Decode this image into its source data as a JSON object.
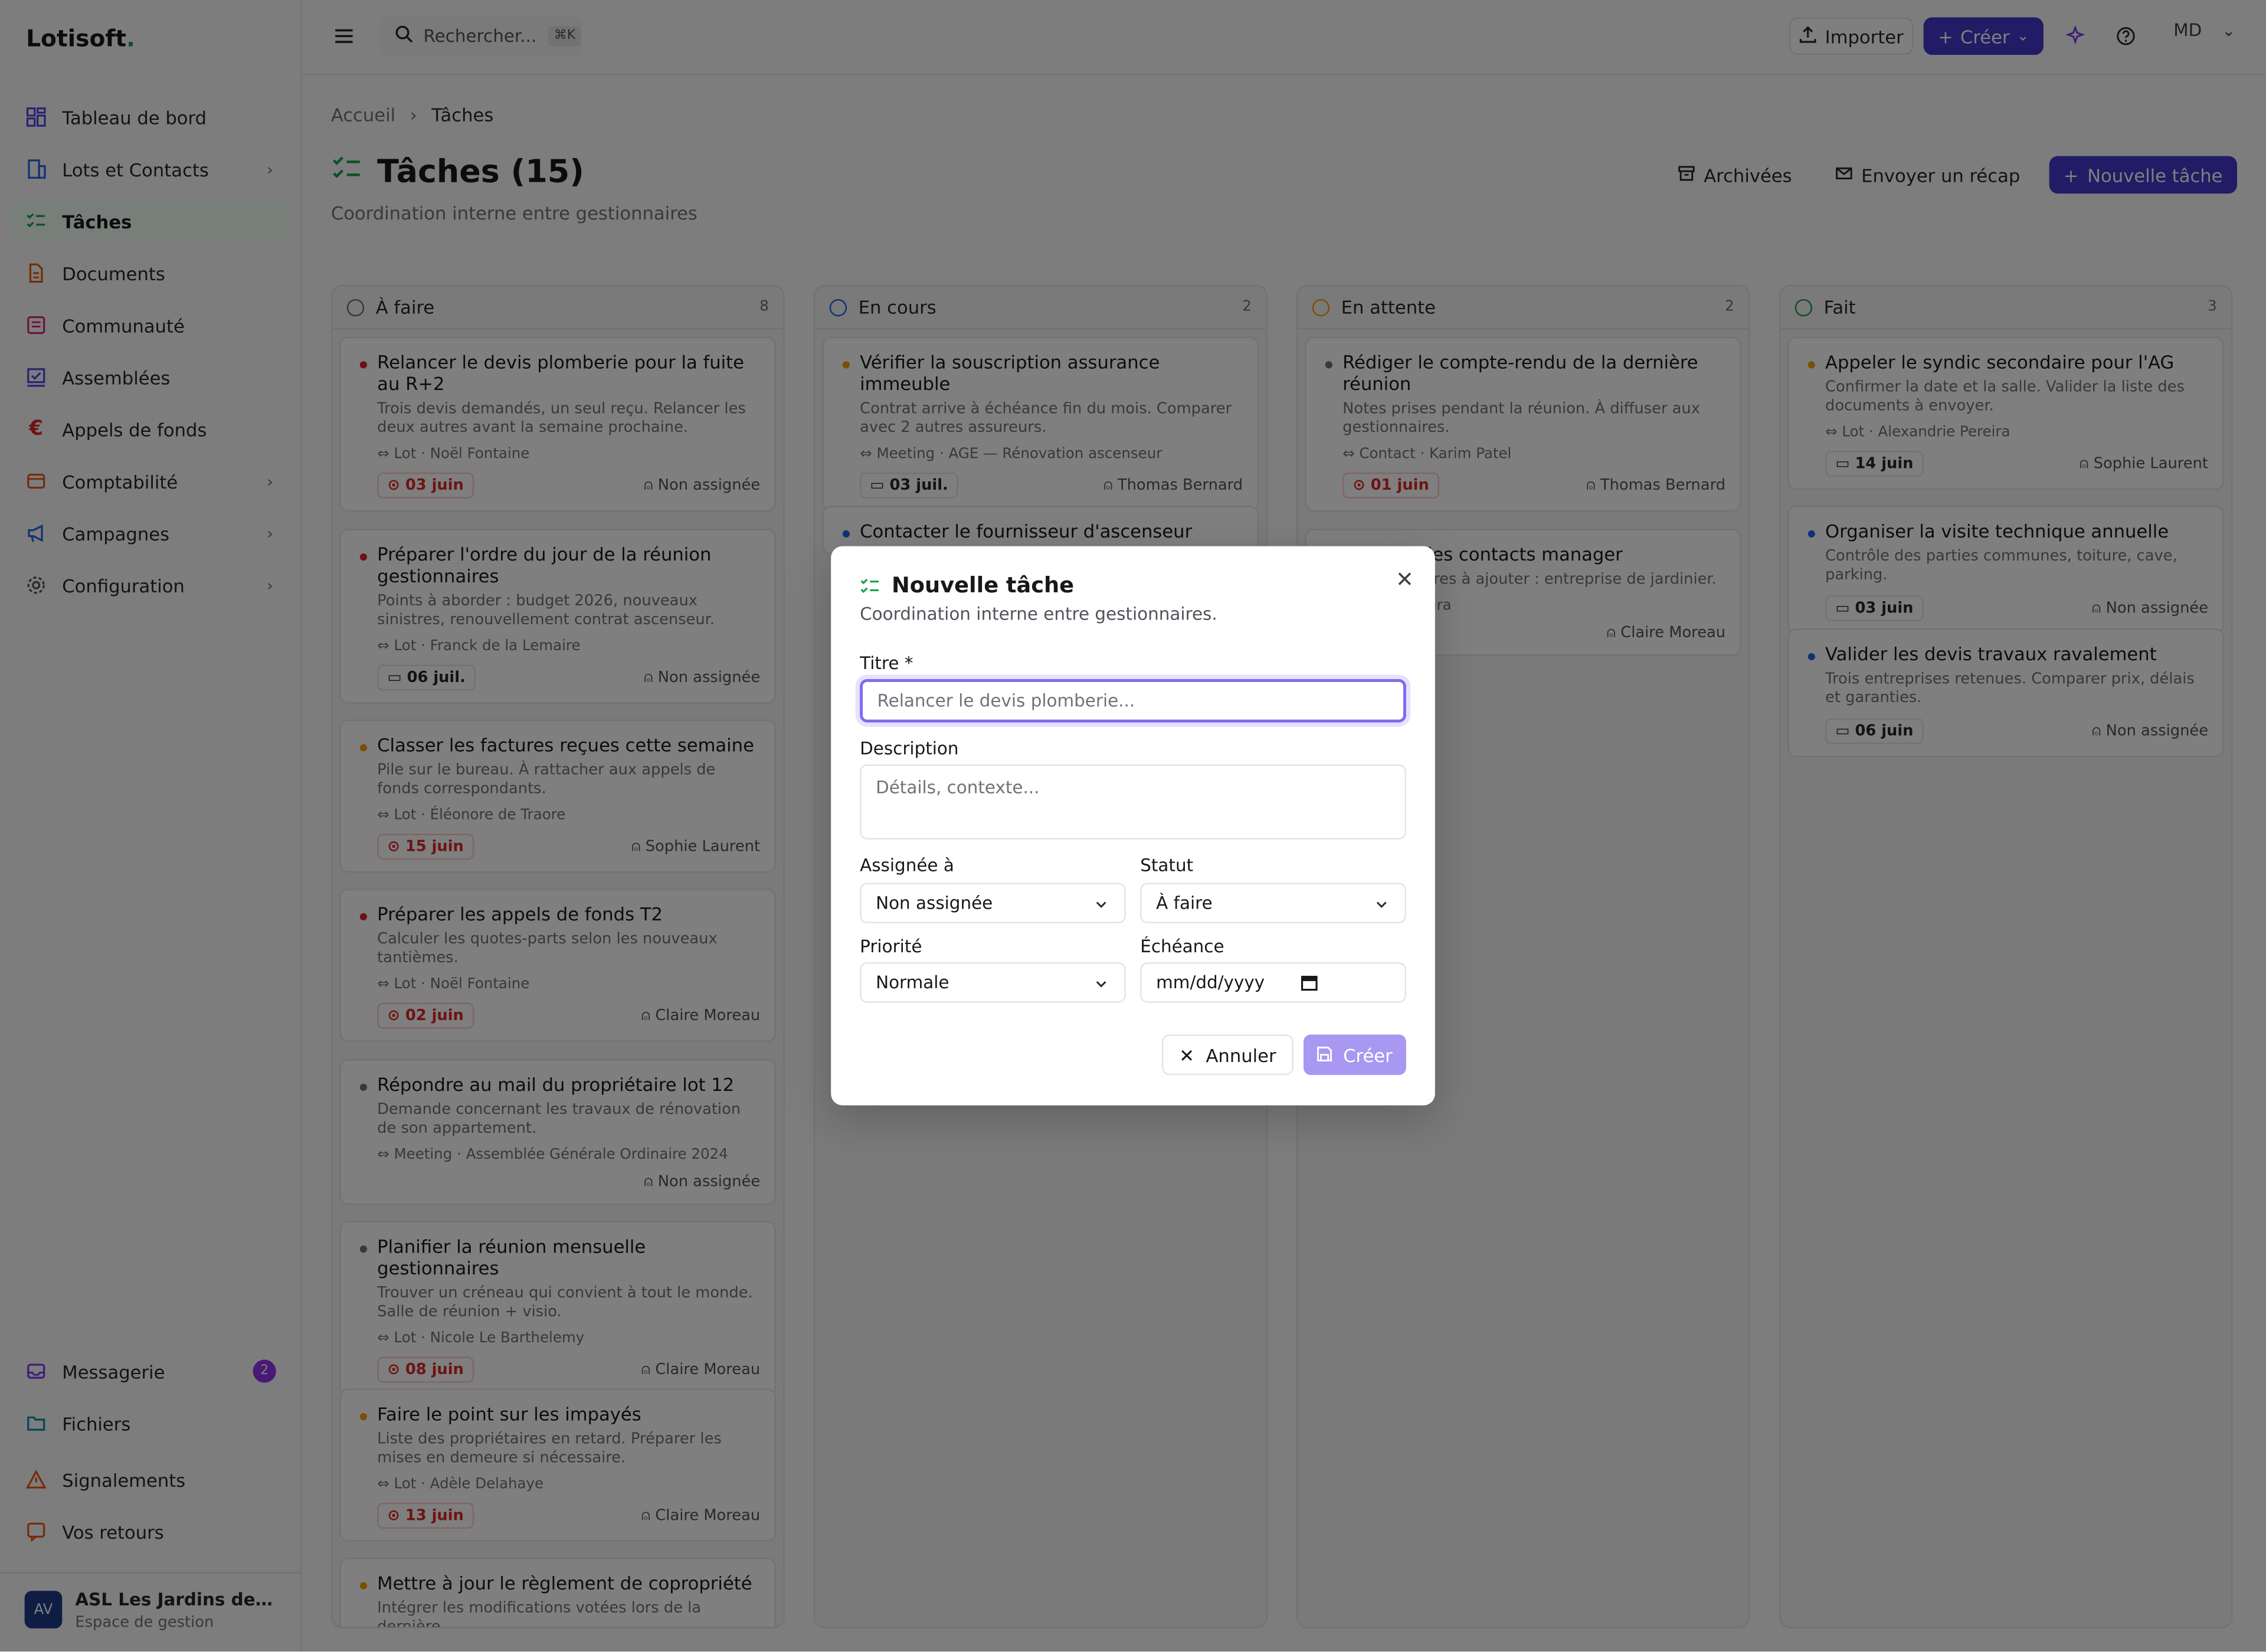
{
  "app": {
    "logo": "Lotisoft",
    "logo_dot": "."
  },
  "sidebar": {
    "items": [
      {
        "label": "Tableau de bord",
        "icon": "dashboard-icon"
      },
      {
        "label": "Lots et Contacts",
        "icon": "building-icon"
      },
      {
        "label": "Tâches",
        "icon": "tasks-icon"
      },
      {
        "label": "Documents",
        "icon": "document-icon"
      },
      {
        "label": "Communauté",
        "icon": "community-icon"
      },
      {
        "label": "Assemblées",
        "icon": "assembly-icon"
      },
      {
        "label": "Appels de fonds",
        "icon": "euro-icon"
      },
      {
        "label": "Comptabilité",
        "icon": "accounting-icon"
      },
      {
        "label": "Campagnes",
        "icon": "megaphone-icon"
      },
      {
        "label": "Configuration",
        "icon": "gear-icon"
      }
    ],
    "bottom": [
      {
        "label": "Messagerie",
        "badge": "2"
      },
      {
        "label": "Fichiers"
      },
      {
        "label": "Signalements"
      },
      {
        "label": "Vos retours"
      }
    ],
    "account": {
      "initials": "AV",
      "name": "ASL Les Jardins de la ...",
      "sub": "Espace de gestion"
    }
  },
  "topbar": {
    "search": "Rechercher...",
    "search_kbd": "⌘K",
    "import": "Importer",
    "create": "Créer",
    "user": "MD"
  },
  "page": {
    "breadcrumb": [
      "Accueil",
      "Tâches"
    ],
    "title": "Tâches (15)",
    "subtitle": "Coordination interne entre gestionnaires",
    "actions": {
      "archived": "Archivées",
      "recap": "Envoyer un récap",
      "new": "Nouvelle tâche"
    }
  },
  "columns": [
    {
      "name": "À faire",
      "count": "8",
      "color": "#71717a",
      "cards": [
        {
          "title": "Relancer le devis plomberie pour la fuite au R+2",
          "desc": "Trois devis demandés, un seul reçu. Relancer les deux autres avant la semaine prochaine.",
          "link": "Lot · Noël Fontaine",
          "date": "03 juin",
          "late": true,
          "assignee": "Non assignée",
          "pcolor": "#dc2626"
        },
        {
          "title": "Préparer l'ordre du jour de la réunion gestionnaires",
          "desc": "Points à aborder : budget 2026, nouveaux sinistres, renouvellement contrat ascenseur.",
          "link": "Lot · Franck de la Lemaire",
          "date": "06 juil.",
          "late": false,
          "assignee": "Non assignée",
          "pcolor": "#dc2626"
        },
        {
          "title": "Classer les factures reçues cette semaine",
          "desc": "Pile sur le bureau. À rattacher aux appels de fonds correspondants.",
          "link": "Lot · Éléonore de Traore",
          "date": "15 juin",
          "late": true,
          "assignee": "Sophie Laurent",
          "pcolor": "#f59e0b"
        },
        {
          "title": "Préparer les appels de fonds T2",
          "desc": "Calculer les quotes-parts selon les nouveaux tantièmes.",
          "link": "Lot · Noël Fontaine",
          "date": "02 juin",
          "late": true,
          "assignee": "Claire Moreau",
          "pcolor": "#dc2626"
        },
        {
          "title": "Répondre au mail du propriétaire lot 12",
          "desc": "Demande concernant les travaux de rénovation de son appartement.",
          "link": "Meeting · Assemblée Générale Ordinaire 2024",
          "date": "",
          "late": false,
          "assignee": "Non assignée",
          "pcolor": "#71717a"
        },
        {
          "title": "Planifier la réunion mensuelle gestionnaires",
          "desc": "Trouver un créneau qui convient à tout le monde. Salle de réunion + visio.",
          "link": "Lot · Nicole Le Barthelemy",
          "date": "08 juin",
          "late": true,
          "assignee": "Claire Moreau",
          "pcolor": "#71717a"
        },
        {
          "title": "Faire le point sur les impayés",
          "desc": "Liste des propriétaires en retard. Préparer les mises en demeure si nécessaire.",
          "link": "Lot · Adèle Delahaye",
          "date": "13 juin",
          "late": true,
          "assignee": "Claire Moreau",
          "pcolor": "#f59e0b"
        },
        {
          "title": "Mettre à jour le règlement de copropriété",
          "desc": "Intégrer les modifications votées lors de la dernière",
          "link": "",
          "date": "",
          "late": false,
          "assignee": "",
          "pcolor": "#f59e0b"
        }
      ]
    },
    {
      "name": "En cours",
      "count": "2",
      "color": "#2563eb",
      "cards": [
        {
          "title": "Vérifier la souscription assurance immeuble",
          "desc": "Contrat arrive à échéance fin du mois. Comparer avec 2 autres assureurs.",
          "link": "Meeting · AGE — Rénovation ascenseur",
          "date": "03 juil.",
          "late": false,
          "assignee": "Thomas Bernard",
          "pcolor": "#f59e0b"
        },
        {
          "title": "Contacter le fournisseur d'ascenseur",
          "desc": "",
          "link": "",
          "date": "",
          "late": false,
          "assignee": "",
          "pcolor": "#2563eb"
        }
      ]
    },
    {
      "name": "En attente",
      "count": "2",
      "color": "#f59e0b",
      "cards": [
        {
          "title": "Rédiger le compte-rendu de la dernière réunion",
          "desc": "Notes prises pendant la réunion. À diffuser aux gestionnaires.",
          "link": "Contact · Karim Patel",
          "date": "01 juin",
          "late": true,
          "assignee": "Thomas Bernard",
          "pcolor": "#71717a"
        },
        {
          "title": "r la liste des contacts manager",
          "desc": "ux prestataires à ajouter : entreprise de jardinier.",
          "link": "ndrie Pereira",
          "date": "",
          "late": false,
          "assignee": "Claire Moreau",
          "pcolor": "#2563eb"
        }
      ]
    },
    {
      "name": "Fait",
      "count": "3",
      "color": "#16a34a",
      "cards": [
        {
          "title": "Appeler le syndic secondaire pour l'AG",
          "desc": "Confirmer la date et la salle. Valider la liste des documents à envoyer.",
          "link": "Lot · Alexandrie Pereira",
          "date": "14 juin",
          "late": false,
          "assignee": "Sophie Laurent",
          "pcolor": "#f59e0b"
        },
        {
          "title": "Organiser la visite technique annuelle",
          "desc": "Contrôle des parties communes, toiture, cave, parking.",
          "link": "",
          "date": "03 juin",
          "late": false,
          "assignee": "Non assignée",
          "pcolor": "#2563eb"
        },
        {
          "title": "Valider les devis travaux ravalement",
          "desc": "Trois entreprises retenues. Comparer prix, délais et garanties.",
          "link": "",
          "date": "06 juin",
          "late": false,
          "assignee": "Non assignée",
          "pcolor": "#2563eb"
        }
      ]
    }
  ],
  "modal": {
    "title": "Nouvelle tâche",
    "subtitle": "Coordination interne entre gestionnaires.",
    "title_label": "Titre *",
    "title_placeholder": "Relancer le devis plomberie...",
    "desc_label": "Description",
    "desc_placeholder": "Détails, contexte...",
    "assignee_label": "Assignée à",
    "assignee_value": "Non assignée",
    "status_label": "Statut",
    "status_value": "À faire",
    "priority_label": "Priorité",
    "priority_value": "Normale",
    "due_label": "Échéance",
    "due_value": "mm/dd/yyyy",
    "cancel": "Annuler",
    "create": "Créer"
  }
}
